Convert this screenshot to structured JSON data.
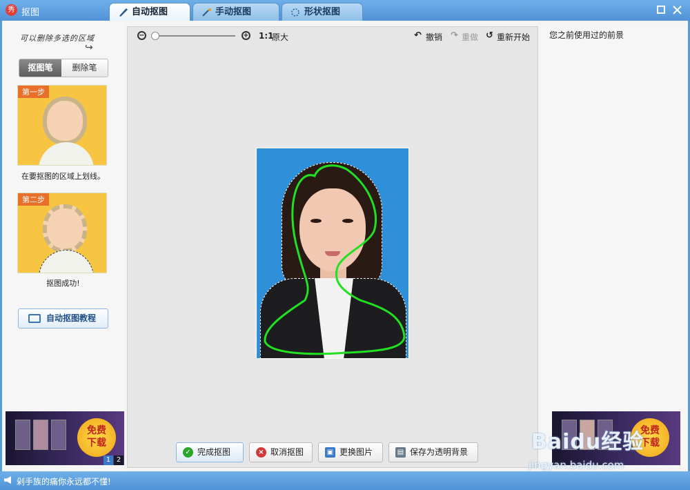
{
  "window": {
    "title": "抠图",
    "app_icon": "秀"
  },
  "tabs": [
    {
      "label": "自动抠图",
      "icon": "brush-icon",
      "active": true
    },
    {
      "label": "手动抠图",
      "icon": "magic-wand-icon",
      "active": false
    },
    {
      "label": "形状抠图",
      "icon": "shape-dots-icon",
      "active": false
    }
  ],
  "left": {
    "hint": "可以删除多选的区域",
    "pens": {
      "cut": "抠图笔",
      "erase": "删除笔"
    },
    "step1": {
      "tag": "第一步",
      "caption": "在要抠图的区域上划线。"
    },
    "step2": {
      "tag": "第二步",
      "caption": "抠图成功!"
    },
    "tutorial_button": "自动抠图教程",
    "ad": {
      "badge_line1": "免费",
      "badge_line2": "下载",
      "pages": [
        "1",
        "2"
      ],
      "current_page": 1
    }
  },
  "toolbar": {
    "zoom_out_icon": "zoom-out-icon",
    "zoom_in_icon": "zoom-in-icon",
    "ratio_label": "1:1",
    "original_label": "原大",
    "undo": "撤销",
    "redo": "重做",
    "restart": "重新开始",
    "zoom_level": 0
  },
  "actions": {
    "finish": "完成抠图",
    "cancel": "取消抠图",
    "replace": "更换图片",
    "save_transparent": "保存为透明背景"
  },
  "right": {
    "title": "您之前使用过的前景",
    "ad": {
      "badge_line1": "免费",
      "badge_line2": "下载"
    }
  },
  "watermark": {
    "brand": "Baidu经验",
    "url": "jingyan.baidu.com"
  },
  "status": {
    "text": "剁手族的痛你永远都不懂!"
  },
  "colors": {
    "titlebar": "#5b9bd5",
    "photo_bg": "#2f8fd8",
    "stroke": "#22e022",
    "ad_badge": "#f0a418"
  }
}
